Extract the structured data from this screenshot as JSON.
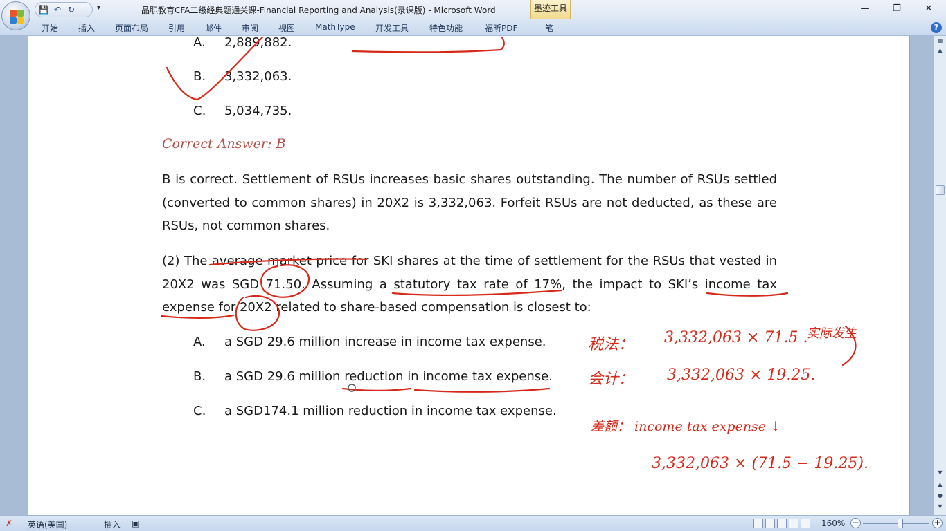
{
  "window": {
    "title": "品职教育CFA二级经典题通关课-Financial Reporting and Analysis(录课版) - Microsoft Word",
    "contextual_tab": "墨迹工具"
  },
  "ribbon": {
    "tabs": [
      "开始",
      "插入",
      "页面布局",
      "引用",
      "邮件",
      "审阅",
      "视图",
      "MathType",
      "开发工具",
      "特色功能",
      "福昕PDF",
      "笔"
    ]
  },
  "document": {
    "q1_options": [
      {
        "letter": "A.",
        "text": "2,889,882."
      },
      {
        "letter": "B.",
        "text": "3,332,063."
      },
      {
        "letter": "C.",
        "text": "5,034,735."
      }
    ],
    "correct_answer": "Correct Answer: B",
    "explanation": "B is correct. Settlement of RSUs increases basic shares outstanding. The number of RSUs settled (converted to common shares) in 20X2 is 3,332,063. Forfeit RSUs are not deducted, as these are RSUs, not common shares.",
    "q2_stem": "(2) The average market price for SKI shares at the time of settlement for the RSUs that vested in 20X2 was SGD 71.50. Assuming a statutory tax rate of 17%, the impact to SKI’s income tax expense for 20X2 related to share-based compensation is closest to:",
    "q2_options": [
      {
        "letter": "A.",
        "text": "a SGD 29.6 million increase in income tax expense."
      },
      {
        "letter": "B.",
        "text": "a SGD 29.6 million reduction in income tax expense."
      },
      {
        "letter": "C.",
        "text": "a SGD174.1 million reduction in income tax expense."
      }
    ]
  },
  "annotations": {
    "tax_label": "税法：",
    "tax_formula": "3,332,063 × 71.5 .",
    "tax_note": "实际发生",
    "acct_label": "会计：",
    "acct_formula": "3,332,063 × 19.25.",
    "diff_label": "差额： income tax expense ↓",
    "diff_formula": "3,332,063 × (71.5 − 19.25)."
  },
  "statusbar": {
    "language": "英语(美国)",
    "mode": "插入",
    "zoom": "160%"
  },
  "colors": {
    "ink": "#d42a1a",
    "correct_answer": "#b2504a",
    "page": "#ffffff",
    "workspace": "#a9bcd6"
  }
}
